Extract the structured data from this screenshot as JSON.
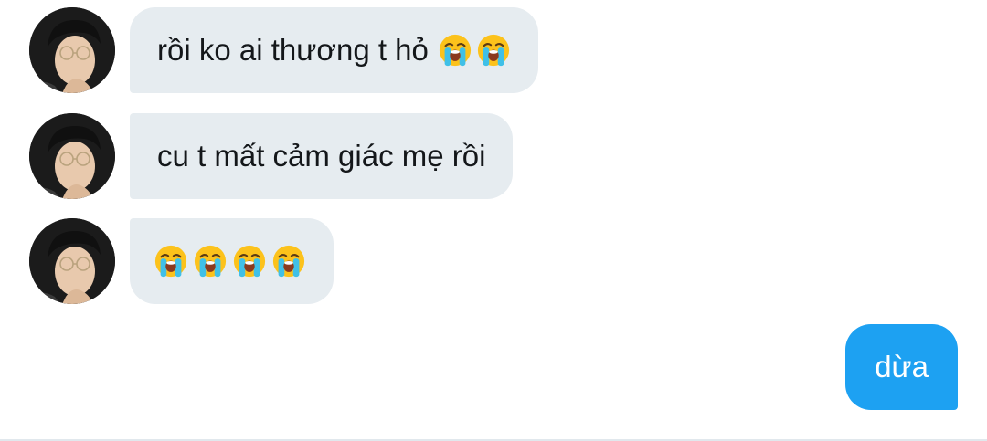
{
  "messages": [
    {
      "sender": "contact",
      "text": "rồi ko ai thương t hỏ",
      "emojis": [
        "loudly-crying-face",
        "loudly-crying-face"
      ]
    },
    {
      "sender": "contact",
      "text": "cu t mất cảm giác mẹ rồi",
      "emojis": []
    },
    {
      "sender": "contact",
      "text": "",
      "emojis": [
        "loudly-crying-face",
        "loudly-crying-face",
        "loudly-crying-face",
        "loudly-crying-face"
      ]
    },
    {
      "sender": "me",
      "text": "dừa",
      "emojis": []
    }
  ],
  "colors": {
    "incoming_bubble": "#e6ecf0",
    "outgoing_bubble": "#1da1f2",
    "incoming_text": "#14171a",
    "outgoing_text": "#ffffff"
  }
}
